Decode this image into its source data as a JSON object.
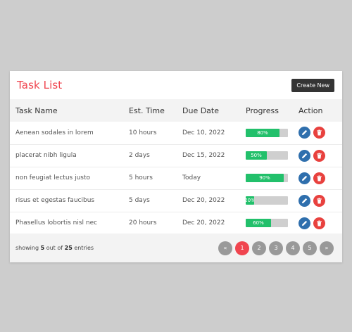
{
  "header": {
    "title": "Task List",
    "create_label": "Create New"
  },
  "table": {
    "columns": [
      "Task Name",
      "Est. Time",
      "Due Date",
      "Progress",
      "Action"
    ],
    "rows": [
      {
        "name": "Aenean sodales in lorem",
        "time": "10 hours",
        "due": "Dec 10, 2022",
        "progress": 80,
        "progress_label": "80%"
      },
      {
        "name": "placerat nibh ligula",
        "time": "2 days",
        "due": "Dec 15, 2022",
        "progress": 50,
        "progress_label": "50%"
      },
      {
        "name": "non feugiat lectus justo",
        "time": "5 hours",
        "due": "Today",
        "progress": 90,
        "progress_label": "90%"
      },
      {
        "name": "risus et egestas faucibus",
        "time": "5 days",
        "due": "Dec 20, 2022",
        "progress": 20,
        "progress_label": "20%"
      },
      {
        "name": "Phasellus lobortis nisl nec",
        "time": "20 hours",
        "due": "Dec 20, 2022",
        "progress": 60,
        "progress_label": "60%"
      }
    ],
    "edit_icon": "pencil-icon",
    "delete_icon": "trash-icon"
  },
  "footer": {
    "showing_prefix": "showing",
    "shown_count": "5",
    "out_of": "out of",
    "total": "25",
    "entries": "entries"
  },
  "pagination": {
    "prev": "«",
    "pages": [
      "1",
      "2",
      "3",
      "4",
      "5"
    ],
    "active_page": "1",
    "next": "»"
  },
  "colors": {
    "accent": "#f0454f",
    "progress": "#22c06b",
    "edit": "#2f6fad",
    "delete": "#e8413e",
    "pager": "#999999"
  }
}
